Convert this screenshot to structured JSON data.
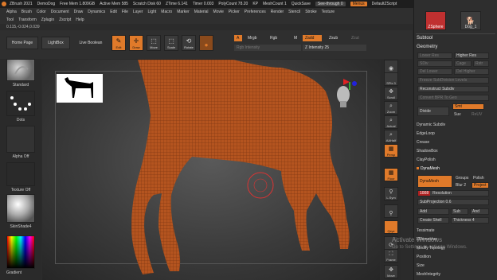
{
  "titlebar": {
    "app": "ZBrush 2021",
    "items": [
      "DemoDog",
      "Free Mem 1.809GB",
      "Active Mem 585",
      "Scratch Disk 60",
      "ZTime 6.141",
      "Timer 0.003",
      "PolyCount 78.20",
      "KP",
      "MeshCount 1"
    ],
    "quicksave": "QuickSave",
    "see_through": "See-through 0",
    "menus_label": "Menus",
    "script_label": "DefaultZScript"
  },
  "menus_row1": [
    "Alpha",
    "Brush",
    "Color",
    "Document",
    "Draw",
    "Dynamics",
    "Edit",
    "File",
    "Layer",
    "Light",
    "Macro",
    "Marker",
    "Material",
    "Movie",
    "Picker",
    "Preferences",
    "Render",
    "Stencil",
    "Stroke",
    "Texture"
  ],
  "menus_row2": [
    "Tool",
    "Transform",
    "Zplugin",
    "Zscript",
    "Help"
  ],
  "coords": "0.115,-0.024,0.039",
  "toolbar": {
    "home_page": "Home Page",
    "lightbox": "LightBox",
    "live_boolean": "Live Boolean",
    "edit": "Edit",
    "draw": "Draw",
    "move": "Move",
    "scale": "Scale",
    "rotate": "Rotate",
    "a_label": "A",
    "mrgb": "Mrgb",
    "rgb": "Rgb",
    "m": "M",
    "zadd": "Zadd",
    "zsub": "Zsub",
    "zcut": "Zcut",
    "rgb_intensity": "Rgb Intensity",
    "z_intensity": "Z Intensity 25"
  },
  "left": {
    "brush_label": "Standard",
    "stroke_label": "Dots",
    "alpha_label": "Alpha Off",
    "texture_label": "Texture Off",
    "material_label": "SkinShade4",
    "gradient_label": "Gradient"
  },
  "right_shelf": [
    "SPix 3",
    "Scroll",
    "Zoom",
    "Actual",
    "AAHalf",
    "Persp",
    "Floor",
    "L.Sym",
    "",
    "Qxyz",
    "",
    "",
    "Frame",
    "Move"
  ],
  "palette": {
    "top_items": [
      "ZSphere",
      "Dog_1"
    ],
    "subtool": "Subtool",
    "geometry": "Geometry",
    "lower_res": "Lower Res",
    "higher_res": "Higher Res",
    "sdiv": "SDiv",
    "cage": "Cage",
    "rstr": "Rstr",
    "del_lower": "Del Lower",
    "del_higher": "Del Higher",
    "freeze_subdiv": "Freeze SubDivision Levels",
    "reconstruct": "Reconstruct Subdiv",
    "convert_bpr": "Convert BPR To Geo",
    "divide": "Divide",
    "smt": "Smt",
    "suv": "Suv",
    "relfv": "ReUV",
    "dynamic_subdiv": "Dynamic Subdiv",
    "edgeloop": "EdgeLoop",
    "crease": "Crease",
    "shadowbox": "ShadowBox",
    "claypolish": "ClayPolish",
    "dynamesh_header": "DynaMesh",
    "dynamesh_btn": "DynaMesh",
    "groups": "Groups",
    "polish": "Polish",
    "blur": "Blur 2",
    "project": "Project",
    "resolution_val": "1008",
    "resolution": "Resolution",
    "subprojection": "SubProjection 0.6",
    "add": "Add",
    "sub": "Sub",
    "and": "And",
    "create_shell": "Create Shell",
    "thickness": "Thickness 4",
    "tessimate": "Tessimate",
    "zremesher": "ZRemesher",
    "modify_topology": "Modify Topology",
    "position": "Position",
    "size": "Size",
    "meshintegrity": "MeshIntegrity"
  },
  "watermark": {
    "line1": "Activate Windows",
    "line2": "Go to Settings to activate Windows."
  },
  "colors": {
    "accent": "#e07a2a",
    "dog": "#b4541f",
    "background": "#2b2b2b"
  }
}
